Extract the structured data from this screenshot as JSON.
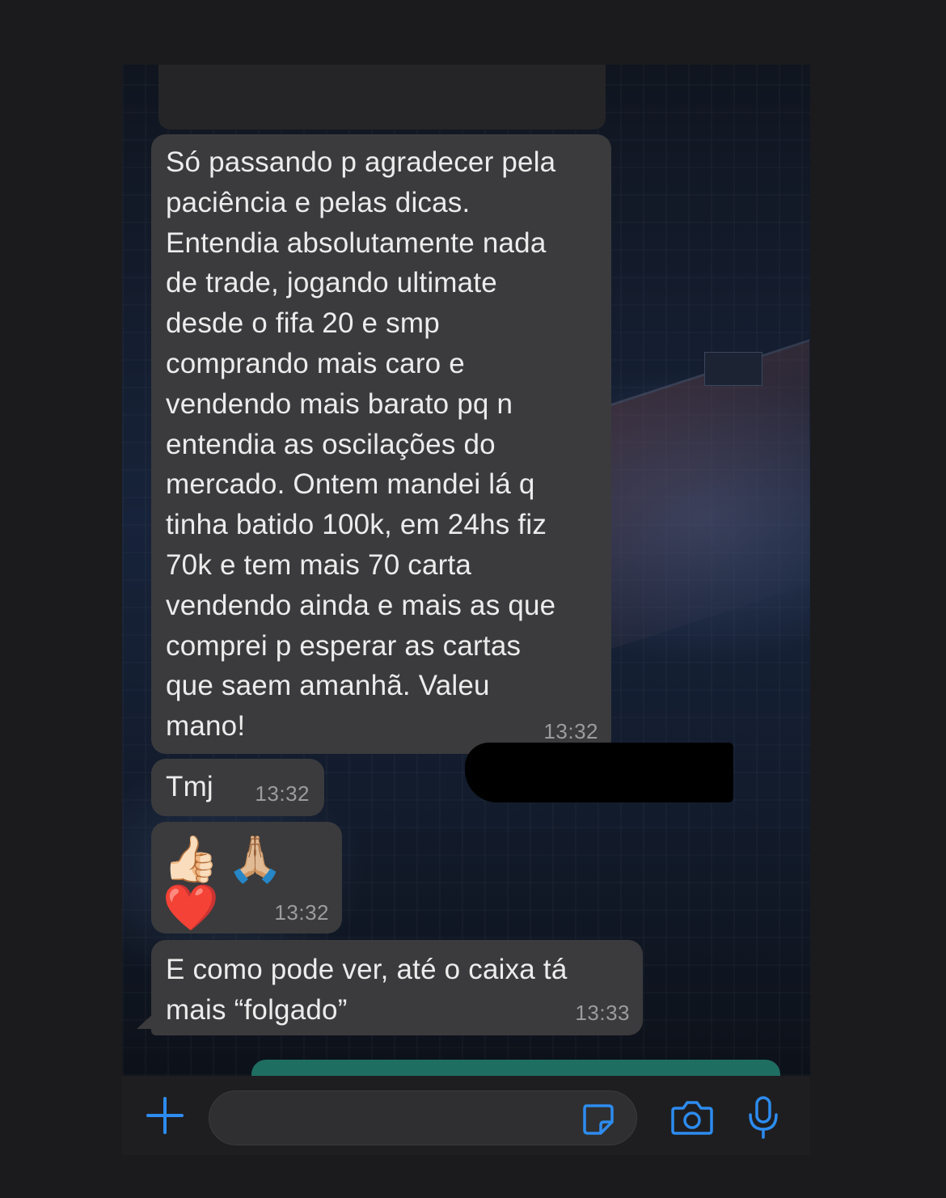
{
  "messages": [
    {
      "text": "Só passando p agradecer pela\npaciência e pelas dicas.\nEntendia absolutamente nada\nde trade, jogando ultimate\ndesde o fifa 20 e smp\ncomprando mais caro e\nvendendo mais barato pq n\nentendia as oscilações do\nmercado. Ontem mandei lá q\ntinha batido 100k, em 24hs fiz\n70k e tem mais 70 carta\nvendendo ainda e mais as que\ncomprei p esperar as cartas\nque saem amanhã. Valeu\nmano!",
      "time": "13:32"
    },
    {
      "text": "Tmj",
      "time": "13:32"
    },
    {
      "text": "👍🏻🙏🏼❤️",
      "time": "13:32"
    },
    {
      "text": "E como pode ver, até o caixa tá\nmais “folgado”",
      "time": "13:33"
    }
  ],
  "composer": {
    "plus_icon": "plus-icon",
    "sticker_icon": "sticker-icon",
    "camera_icon": "camera-icon",
    "mic_icon": "microphone-icon",
    "accent_color": "#2d8cf0"
  },
  "colors": {
    "incoming_bubble": "#3b3b3d",
    "outgoing_bubble": "#1f6e62",
    "timestamp": "#9c9c9e"
  }
}
